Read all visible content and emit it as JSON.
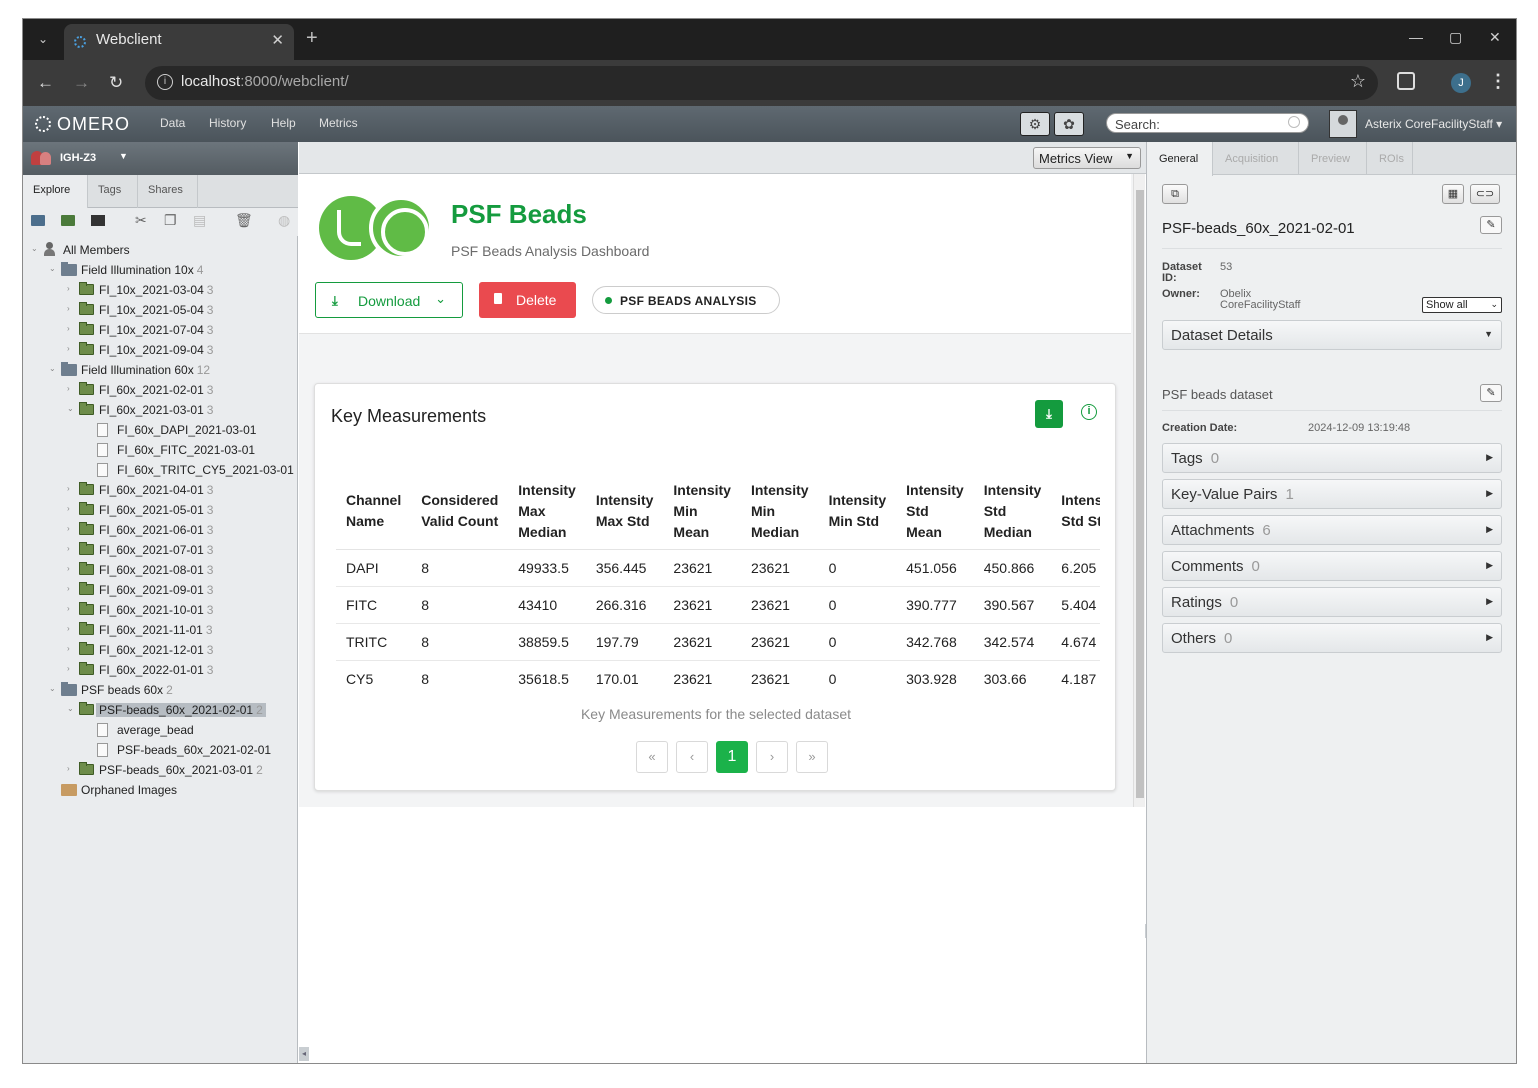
{
  "browser": {
    "tab_title": "Webclient",
    "url_host": "localhost",
    "url_path": ":8000/webclient/",
    "profile_initial": "J"
  },
  "omero": {
    "logo": "OMERO",
    "nav": [
      "Data",
      "History",
      "Help",
      "Metrics"
    ],
    "search_label": "Search:",
    "user_name": "Asterix CoreFacilityStaff ▾"
  },
  "left": {
    "group": "IGH-Z3",
    "tabs": [
      "Explore",
      "Tags",
      "Shares"
    ],
    "tree": [
      {
        "label": "All Members",
        "count": "",
        "type": "root"
      },
      {
        "label": "Field Illumination 10x",
        "count": "4",
        "type": "project"
      },
      {
        "label": "FI_10x_2021-03-04",
        "count": "3",
        "type": "dataset"
      },
      {
        "label": "FI_10x_2021-05-04",
        "count": "3",
        "type": "dataset"
      },
      {
        "label": "FI_10x_2021-07-04",
        "count": "3",
        "type": "dataset"
      },
      {
        "label": "FI_10x_2021-09-04",
        "count": "3",
        "type": "dataset"
      },
      {
        "label": "Field Illumination 60x",
        "count": "12",
        "type": "project"
      },
      {
        "label": "FI_60x_2021-02-01",
        "count": "3",
        "type": "dataset"
      },
      {
        "label": "FI_60x_2021-03-01",
        "count": "3",
        "type": "dataset"
      },
      {
        "label": "FI_60x_DAPI_2021-03-01",
        "count": "",
        "type": "image"
      },
      {
        "label": "FI_60x_FITC_2021-03-01",
        "count": "",
        "type": "image"
      },
      {
        "label": "FI_60x_TRITC_CY5_2021-03-01",
        "count": "",
        "type": "image"
      },
      {
        "label": "FI_60x_2021-04-01",
        "count": "3",
        "type": "dataset"
      },
      {
        "label": "FI_60x_2021-05-01",
        "count": "3",
        "type": "dataset"
      },
      {
        "label": "FI_60x_2021-06-01",
        "count": "3",
        "type": "dataset"
      },
      {
        "label": "FI_60x_2021-07-01",
        "count": "3",
        "type": "dataset"
      },
      {
        "label": "FI_60x_2021-08-01",
        "count": "3",
        "type": "dataset"
      },
      {
        "label": "FI_60x_2021-09-01",
        "count": "3",
        "type": "dataset"
      },
      {
        "label": "FI_60x_2021-10-01",
        "count": "3",
        "type": "dataset"
      },
      {
        "label": "FI_60x_2021-11-01",
        "count": "3",
        "type": "dataset"
      },
      {
        "label": "FI_60x_2021-12-01",
        "count": "3",
        "type": "dataset"
      },
      {
        "label": "FI_60x_2022-01-01",
        "count": "3",
        "type": "dataset"
      },
      {
        "label": "PSF beads 60x",
        "count": "2",
        "type": "project"
      },
      {
        "label": "PSF-beads_60x_2021-02-01",
        "count": "2",
        "type": "dataset"
      },
      {
        "label": "average_bead",
        "count": "",
        "type": "image"
      },
      {
        "label": "PSF-beads_60x_2021-02-01",
        "count": "",
        "type": "image"
      },
      {
        "label": "PSF-beads_60x_2021-03-01",
        "count": "2",
        "type": "dataset"
      },
      {
        "label": "Orphaned Images",
        "count": "",
        "type": "orphaned"
      }
    ]
  },
  "center": {
    "view_select": "Metrics View",
    "title": "PSF Beads",
    "subtitle": "PSF Beads Analysis Dashboard",
    "download_label": "Download",
    "delete_label": "Delete",
    "analysis_tag": "PSF BEADS ANALYSIS",
    "key_measurements": {
      "title": "Key Measurements",
      "columns": [
        [
          "Channel",
          "Name"
        ],
        [
          "Considered",
          "Valid Count"
        ],
        [
          "Intensity",
          "Max",
          "Median"
        ],
        [
          "Intensity",
          "Max Std"
        ],
        [
          "Intensity",
          "Min",
          "Mean"
        ],
        [
          "Intensity",
          "Min",
          "Median"
        ],
        [
          "Intensity",
          "Min Std"
        ],
        [
          "Intensity",
          "Std",
          "Mean"
        ],
        [
          "Intensity",
          "Std",
          "Median"
        ],
        [
          "Intensity",
          "Std Std"
        ]
      ],
      "rows": [
        [
          "DAPI",
          "8",
          "49933.5",
          "356.445",
          "23621",
          "23621",
          "0",
          "451.056",
          "450.866",
          "6.205"
        ],
        [
          "FITC",
          "8",
          "43410",
          "266.316",
          "23621",
          "23621",
          "0",
          "390.777",
          "390.567",
          "5.404"
        ],
        [
          "TRITC",
          "8",
          "38859.5",
          "197.79",
          "23621",
          "23621",
          "0",
          "342.768",
          "342.574",
          "4.674"
        ],
        [
          "CY5",
          "8",
          "35618.5",
          "170.01",
          "23621",
          "23621",
          "0",
          "303.928",
          "303.66",
          "4.187"
        ]
      ],
      "caption": "Key Measurements for the selected dataset",
      "current_page": "1"
    }
  },
  "right": {
    "tabs": [
      "General",
      "Acquisition",
      "Preview",
      "ROIs"
    ],
    "name": "PSF-beads_60x_2021-02-01",
    "dataset_id_label": "Dataset ID:",
    "dataset_id": "53",
    "owner_label": "Owner:",
    "owner_line1": "Obelix",
    "owner_line2": "CoreFacilityStaff",
    "show_all": "Show all",
    "dataset_details": "Dataset Details",
    "description": "PSF beads dataset",
    "creation_label": "Creation Date:",
    "creation_date": "2024-12-09 13:19:48",
    "sections": [
      {
        "label": "Tags",
        "count": "0"
      },
      {
        "label": "Key-Value Pairs",
        "count": "1"
      },
      {
        "label": "Attachments",
        "count": "6"
      },
      {
        "label": "Comments",
        "count": "0"
      },
      {
        "label": "Ratings",
        "count": "0"
      },
      {
        "label": "Others",
        "count": "0"
      }
    ]
  },
  "colors": {
    "accent_green": "#149b3e",
    "delete_red": "#ea4a4f",
    "omero_bar": "#545c62"
  }
}
